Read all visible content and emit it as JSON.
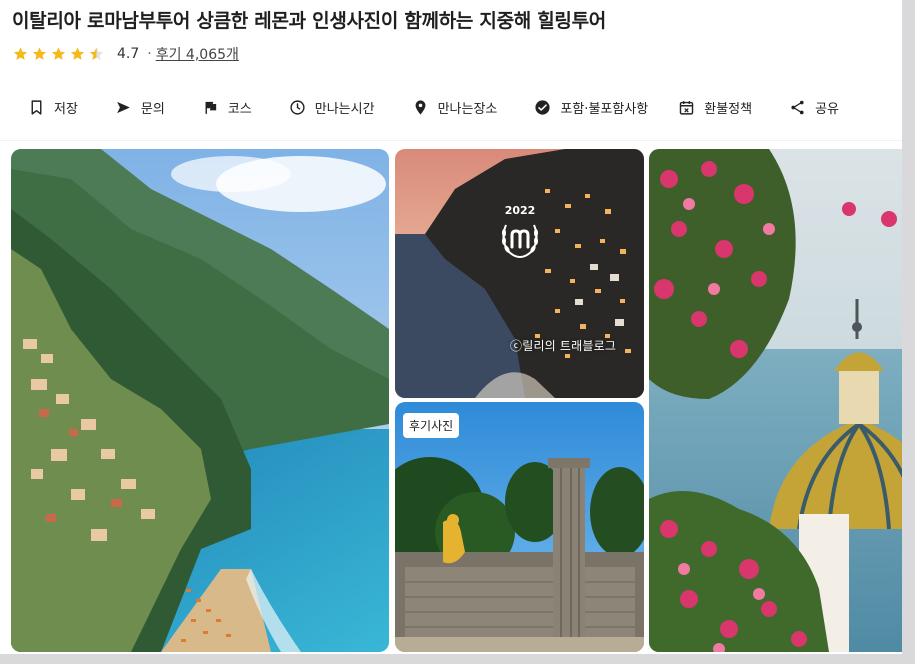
{
  "title": "이탈리아 로마남부투어 상큼한 레몬과 인생사진이 함께하는 지중해 힐링투어",
  "rating": {
    "value": "4.7",
    "separator": "·",
    "reviews": "후기 4,065개",
    "stars": 4.5,
    "star_color": "#f5b91c"
  },
  "actions": [
    {
      "label": "저장",
      "icon": "bookmark-icon"
    },
    {
      "label": "문의",
      "icon": "send-icon"
    },
    {
      "label": "코스",
      "icon": "flag-icon"
    },
    {
      "label": "만나는시간",
      "icon": "clock-icon"
    },
    {
      "label": "만나는장소",
      "icon": "location-pin-icon"
    },
    {
      "label": "포함·불포함사항",
      "icon": "check-circle-icon"
    },
    {
      "label": "환불정책",
      "icon": "calendar-icon"
    },
    {
      "label": "공유",
      "icon": "share-icon"
    }
  ],
  "photos": {
    "award_year": "2022",
    "watermark": "ⓒ릴리의 트래블로그",
    "review_tag": "후기사진"
  }
}
